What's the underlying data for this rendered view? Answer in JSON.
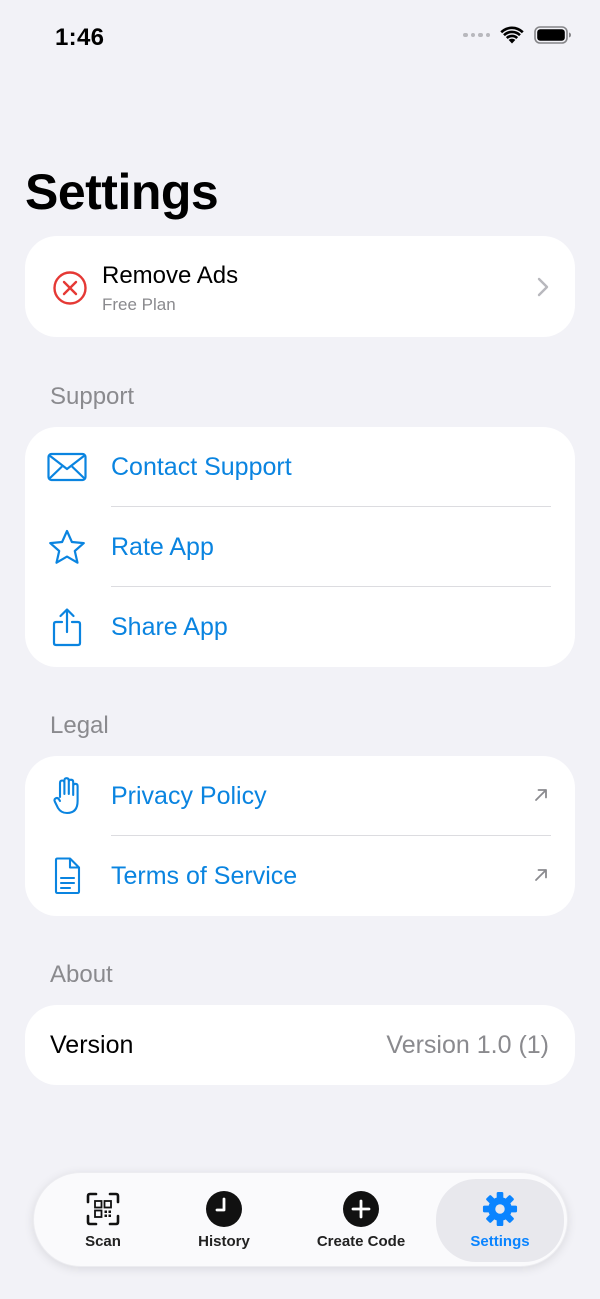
{
  "status_bar": {
    "time": "1:46"
  },
  "title": "Settings",
  "remove_ads": {
    "title": "Remove Ads",
    "subtitle": "Free Plan",
    "icon": "x-circle-icon"
  },
  "sections": {
    "support": {
      "header": "Support",
      "items": [
        {
          "label": "Contact Support",
          "icon": "envelope-icon"
        },
        {
          "label": "Rate App",
          "icon": "star-icon"
        },
        {
          "label": "Share App",
          "icon": "share-icon"
        }
      ]
    },
    "legal": {
      "header": "Legal",
      "items": [
        {
          "label": "Privacy Policy",
          "icon": "hand-icon"
        },
        {
          "label": "Terms of Service",
          "icon": "document-icon"
        }
      ]
    },
    "about": {
      "header": "About",
      "version_label": "Version",
      "version_value": "Version 1.0 (1)"
    }
  },
  "tab_bar": {
    "tabs": [
      {
        "label": "Scan",
        "icon": "qr-scan-icon"
      },
      {
        "label": "History",
        "icon": "clock-icon"
      },
      {
        "label": "Create Code",
        "icon": "plus-circle-icon"
      },
      {
        "label": "Settings",
        "icon": "gear-icon",
        "active": true
      }
    ]
  },
  "colors": {
    "accent": "#0a84e0",
    "destructive": "#e53935",
    "background": "#f2f2f7",
    "secondary_text": "#8a8a8e"
  }
}
